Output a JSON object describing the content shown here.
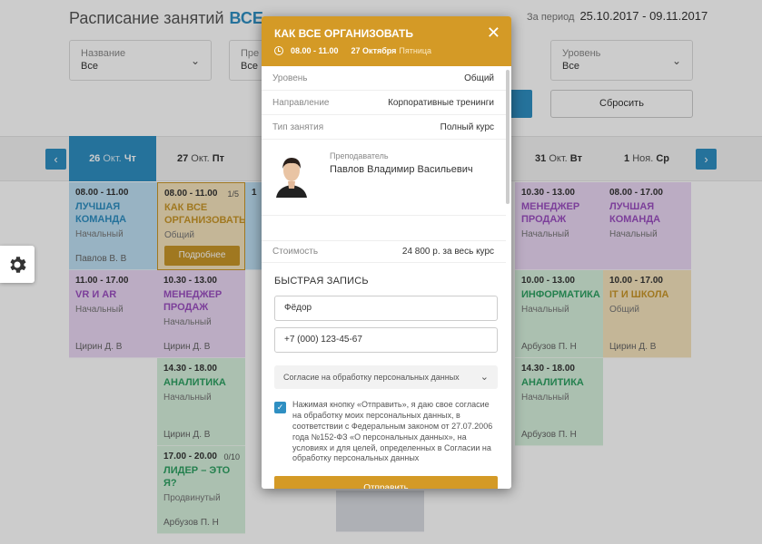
{
  "header": {
    "title": "Расписание занятий",
    "category": "ВСЕ",
    "period_label": "За период",
    "period_value": "25.10.2017 - 09.11.2017"
  },
  "filters": [
    {
      "label": "Название",
      "value": "Все"
    },
    {
      "label": "Пре",
      "value": "Все"
    },
    {
      "label": "Уровень",
      "value": "Все"
    }
  ],
  "reset_label": "Сбросить",
  "nav": {
    "prev": "‹",
    "next": "›"
  },
  "days": [
    {
      "num": "26",
      "mon": "Окт.",
      "wd": "Чт"
    },
    {
      "num": "27",
      "mon": "Окт.",
      "wd": "Пт"
    },
    {
      "num": "31",
      "mon": "Окт.",
      "wd": "Вт"
    },
    {
      "num": "1",
      "mon": "Ноя.",
      "wd": "Ср"
    }
  ],
  "cards": [
    {
      "time": "08.00 - 11.00",
      "name": "ЛУЧШАЯ КОМАНДА",
      "level": "Начальный",
      "teacher": "Павлов В. В"
    },
    {
      "time": "11.00 - 17.00",
      "name": "VR И AR",
      "level": "Начальный",
      "teacher": "Цирин Д. В"
    },
    {
      "time": "08.00 - 11.00",
      "count": "1/5",
      "name": "КАК ВСЕ ОРГАНИЗОВАТЬ",
      "level": "Общий",
      "more": "Подробнее"
    },
    {
      "time": "10.30 - 13.00",
      "name": "МЕНЕДЖЕР ПРОДАЖ",
      "level": "Начальный",
      "teacher": "Цирин Д. В"
    },
    {
      "time": "14.30 - 18.00",
      "name": "АНАЛИТИКА",
      "level": "Начальный",
      "teacher": "Цирин Д. В"
    },
    {
      "time": "17.00 - 20.00",
      "count": "0/10",
      "name": "ЛИДЕР – ЭТО Я?",
      "level": "Продвинутый",
      "teacher": "Арбузов П. Н"
    },
    {
      "time": "10.30 - 13.00",
      "name": "МЕНЕДЖЕР ПРОДАЖ",
      "level": "Начальный"
    },
    {
      "time": "10.00 - 13.00",
      "name": "ИНФОРМАТИКА",
      "level": "Начальный",
      "teacher": "Арбузов П. Н"
    },
    {
      "time": "14.30 - 18.00",
      "name": "АНАЛИТИКА",
      "level": "Начальный",
      "teacher": "Арбузов П. Н"
    },
    {
      "time": "08.00 - 17.00",
      "name": "ЛУЧШАЯ КОМАНДА",
      "level": "Начальный"
    },
    {
      "time": "10.00 - 17.00",
      "name": "IT И ШКОЛА",
      "level": "Общий",
      "teacher": "Цирин Д. В"
    },
    {
      "time": "1",
      "name": "",
      "level": ""
    }
  ],
  "modal": {
    "title": "КАК ВСЕ ОРГАНИЗОВАТЬ",
    "close": "✕",
    "time": "08.00 - 11.00",
    "date": "27 Октября",
    "weekday": "Пятница",
    "details": [
      {
        "key": "Уровень",
        "value": "Общий"
      },
      {
        "key": "Направление",
        "value": "Корпоративные тренинги"
      },
      {
        "key": "Тип занятия",
        "value": "Полный курс"
      }
    ],
    "teacher_label": "Преподаватель",
    "teacher_name": "Павлов Владимир Васильевич",
    "price_label": "Стоимость",
    "price_value": "24 800 р. за весь курс",
    "quick_title": "БЫСТРАЯ ЗАПИСЬ",
    "name_value": "Фёдор",
    "phone_value": "+7 (000) 123-45-67",
    "consent_dropdown": "Согласие на обработку персональных данных",
    "consent_text": "Нажимая кнопку «Отправить», я даю свое согласие на обработку моих персональных данных, в соответствии с Федеральным законом от 27.07.2006 года №152-ФЗ «О персональных данных», на условиях и для целей, определенных в Согласии на обработку персональных данных",
    "send_label": "Отправить"
  },
  "colors": {
    "accent": "#2f8fc2",
    "gold": "#d49a26"
  }
}
